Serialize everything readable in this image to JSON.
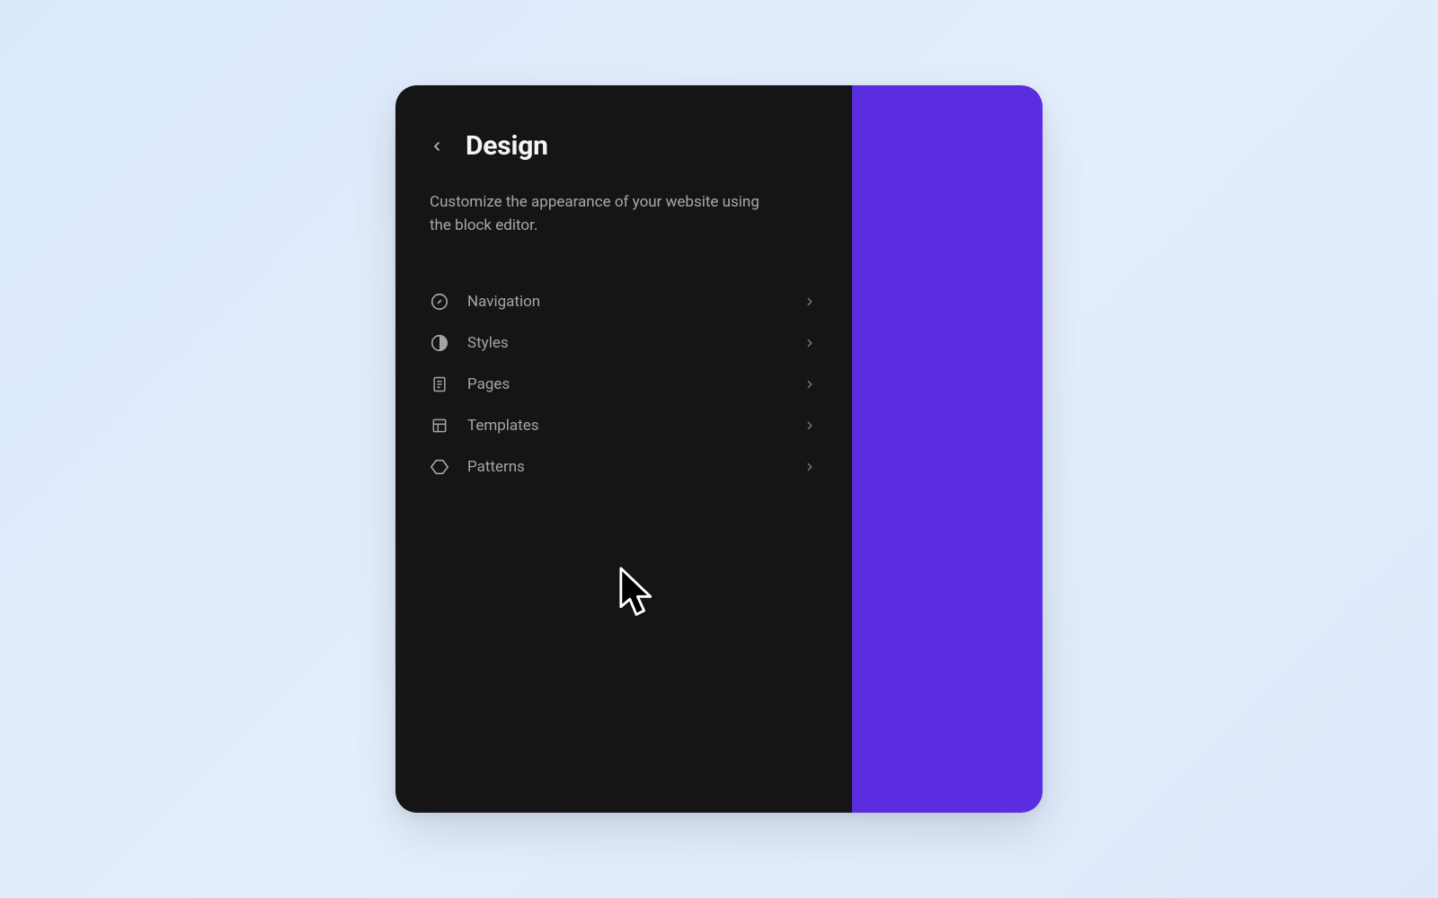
{
  "header": {
    "title": "Design"
  },
  "description": "Customize the appearance of your website using the block editor.",
  "menu": {
    "items": [
      {
        "label": "Navigation",
        "icon": "compass"
      },
      {
        "label": "Styles",
        "icon": "half-circle"
      },
      {
        "label": "Pages",
        "icon": "page"
      },
      {
        "label": "Templates",
        "icon": "layout"
      },
      {
        "label": "Patterns",
        "icon": "diamond"
      }
    ]
  },
  "colors": {
    "sidebar_bg": "#151515",
    "preview_bg": "#5a2de0",
    "page_bg": "#dbe9fb"
  }
}
